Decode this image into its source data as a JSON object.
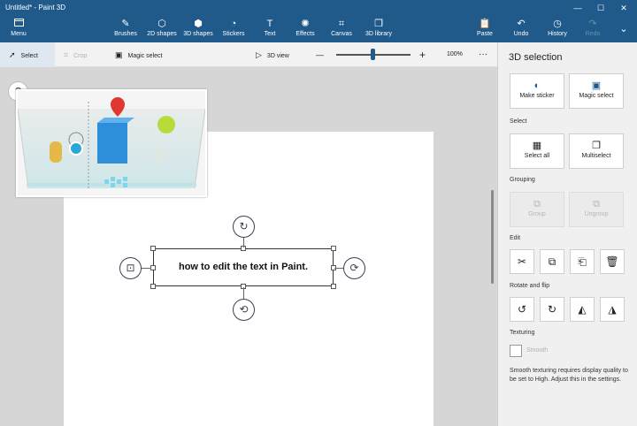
{
  "window": {
    "title": "Untitled* - Paint 3D",
    "controls": [
      "—",
      "☐",
      "✕"
    ]
  },
  "ribbon": {
    "menu": {
      "label": "Menu",
      "icon": "folder-icon"
    },
    "tools": [
      {
        "label": "Brushes",
        "icon": "brush-icon"
      },
      {
        "label": "2D shapes",
        "icon": "2d-shapes-icon"
      },
      {
        "label": "3D shapes",
        "icon": "3d-shapes-icon"
      },
      {
        "label": "Stickers",
        "icon": "stickers-icon"
      },
      {
        "label": "Text",
        "icon": "text-icon"
      },
      {
        "label": "Effects",
        "icon": "effects-icon"
      },
      {
        "label": "Canvas",
        "icon": "canvas-icon"
      },
      {
        "label": "3D library",
        "icon": "3d-library-icon"
      }
    ],
    "actions": [
      {
        "label": "Paste",
        "icon": "paste-icon"
      },
      {
        "label": "Undo",
        "icon": "undo-icon"
      },
      {
        "label": "History",
        "icon": "history-icon"
      },
      {
        "label": "Redo",
        "icon": "redo-icon"
      }
    ],
    "more_icon": "chevron-down-icon"
  },
  "toolbar": {
    "select": "Select",
    "crop": "Crop",
    "magic_select": "Magic select",
    "view_3d": "3D view",
    "zoom_minus": "—",
    "zoom_plus": "+",
    "zoom_level": "100%",
    "more": "···"
  },
  "canvas": {
    "text": "how to edit the text in Paint.",
    "help": "?"
  },
  "panel": {
    "title": "3D selection",
    "make_sticker": "Make sticker",
    "magic_select": "Magic select",
    "select_section": "Select",
    "select_all": "Select all",
    "multiselect": "Multiselect",
    "grouping_section": "Grouping",
    "group": "Group",
    "ungroup": "Ungroup",
    "edit_section": "Edit",
    "rotate_section": "Rotate and flip",
    "texturing_section": "Texturing",
    "smooth": "Smooth",
    "note": "Smooth texturing requires display quality to be set to High. Adjust this in the settings."
  },
  "colors": {
    "ribbon": "#1f5a8b",
    "panel": "#f0f0f0",
    "workspace": "#d6d6d6",
    "accent": "#1f5a8b"
  }
}
